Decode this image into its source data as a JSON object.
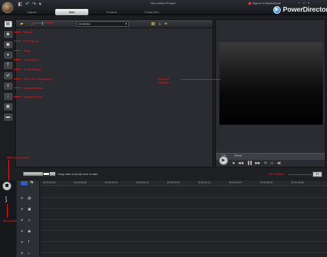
{
  "window": {
    "title": "New Untitled Project",
    "signin": "Sign in to DirectorZone",
    "controls": [
      "–",
      "□",
      "×"
    ]
  },
  "quick_access": [
    "◧",
    "↶",
    "↷",
    "▾"
  ],
  "mode_tabs": [
    {
      "label": "Capture",
      "active": false
    },
    {
      "label": "Edit",
      "active": true
    },
    {
      "label": "Produce",
      "active": false
    },
    {
      "label": "Create Disc",
      "active": false
    }
  ],
  "brand": {
    "name": "PowerDirector",
    "icon": "powerdirector-logo-icon"
  },
  "left_tools": [
    {
      "name": "media-room-icon",
      "glyph": "▤"
    },
    {
      "name": "effect-room-icon",
      "glyph": "◉"
    },
    {
      "name": "pip-objects-room-icon",
      "glyph": "▣"
    },
    {
      "name": "particle-room-icon",
      "glyph": "●"
    },
    {
      "name": "title-room-icon",
      "glyph": "T"
    },
    {
      "name": "transition-room-icon",
      "glyph": "⇄"
    },
    {
      "name": "audio-mixing-room-icon",
      "glyph": "≡"
    },
    {
      "name": "voice-over-recording-icon",
      "glyph": "♪"
    },
    {
      "name": "chapter-room-icon",
      "glyph": "▦"
    },
    {
      "name": "subtitle-room-icon",
      "glyph": "▬"
    }
  ],
  "library": {
    "filter_value": "All Media",
    "annotations": {
      "library": "Library",
      "rooms": [
        "Effects",
        "PiP Objects",
        "Titles",
        "Transitions",
        "Audio Mixing",
        "Voice-over Recording",
        "Chapter Room",
        "Subtitle Room"
      ],
      "preview": "Preview window",
      "make_movie": "Make your movie",
      "story_mode": "Story Mode",
      "fit_timeline": "Fit Timeline"
    }
  },
  "preview": {
    "tabs": [
      "Clip",
      "Movie"
    ],
    "play_glyph": "▶",
    "controls": [
      "■",
      "◀◀",
      "▐▐",
      "▶▶",
      "⟲",
      "▭",
      "◀)"
    ]
  },
  "timeline": {
    "tip": "Drag video or photo here to start",
    "fit_label": "Fit",
    "timecode_icon": "timecode-icon",
    "timecode_label": "fx",
    "ticks": [
      "00:00:00:00",
      "00:00:08:08",
      "00:00:16:16",
      "00:00:24:24",
      "00:00:33:03",
      "00:00:41:11",
      "00:00:49:19",
      "00:00:58:00",
      "00:01:06:06",
      "00:01:14:14"
    ],
    "track_icons": [
      [
        "✔",
        "▤"
      ],
      [
        "✔",
        "▣"
      ],
      [
        "✔",
        "♫"
      ],
      [
        "✔",
        "◉"
      ],
      [
        "✔",
        "T"
      ],
      [
        "✔",
        "♪"
      ],
      [
        "✔",
        "♫"
      ]
    ]
  },
  "colors": {
    "annotation": "#e01818",
    "background": "#1c1e22",
    "accent": "#2b5fb8"
  }
}
